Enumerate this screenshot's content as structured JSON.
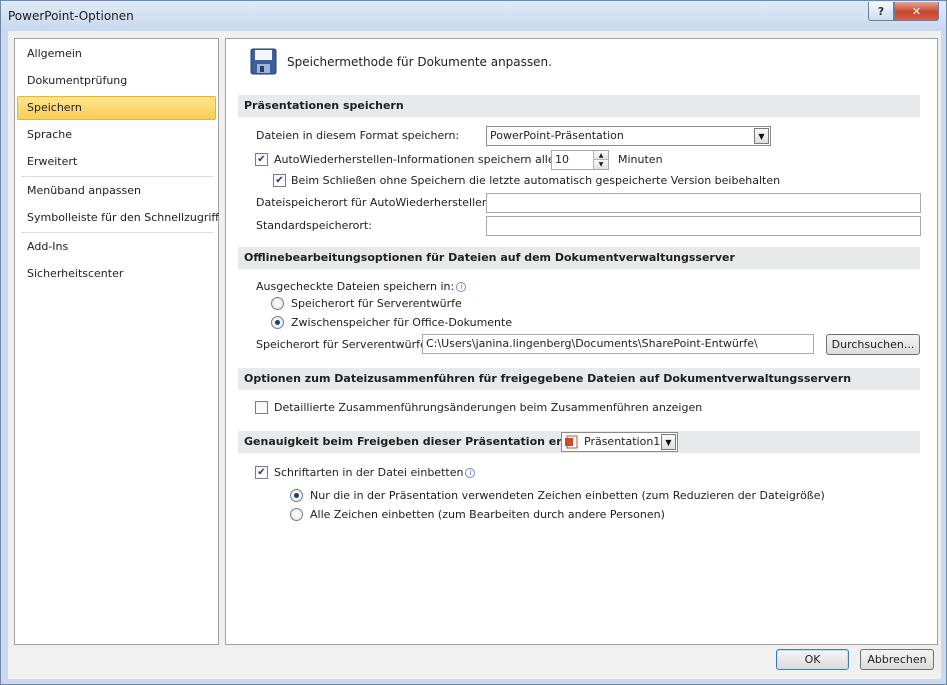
{
  "window": {
    "title": "PowerPoint-Optionen",
    "help_glyph": "?",
    "close_glyph": "✕"
  },
  "nav": {
    "items": [
      {
        "label": "Allgemein"
      },
      {
        "label": "Dokumentprüfung"
      },
      {
        "label": "Speichern"
      },
      {
        "label": "Sprache"
      },
      {
        "label": "Erweitert"
      },
      {
        "label": "Menüband anpassen"
      },
      {
        "label": "Symbolleiste für den Schnellzugriff"
      },
      {
        "label": "Add-Ins"
      },
      {
        "label": "Sicherheitscenter"
      }
    ],
    "selected": "Speichern"
  },
  "header": {
    "icon": "floppy-disk-icon",
    "text": "Speichermethode für Dokumente anpassen."
  },
  "save_section": {
    "title": "Präsentationen speichern",
    "format_label": "Dateien in diesem Format speichern:",
    "format_value": "PowerPoint-Präsentation",
    "autorecover_label": "AutoWiederherstellen-Informationen speichern alle",
    "autorecover_checked": true,
    "autorecover_minutes": "10",
    "minutes_label": "Minuten",
    "keep_last_label": "Beim Schließen ohne Speichern die letzte automatisch gespeicherte Version beibehalten",
    "keep_last_checked": true,
    "autorecover_location_label": "Dateispeicherort für AutoWiederherstellen:",
    "autorecover_location_value": "",
    "default_location_label": "Standardspeicherort:",
    "default_location_value": ""
  },
  "offline_section": {
    "title": "Offlinebearbeitungsoptionen für Dateien auf dem Dokumentverwaltungsserver",
    "checkout_label": "Ausgecheckte Dateien speichern in:",
    "radio_server_drafts": "Speicherort für Serverentwürfe",
    "radio_office_cache": "Zwischenspeicher für Office-Dokumente",
    "selected_radio": "office_cache",
    "drafts_location_label": "Speicherort für Serverentwürfe:",
    "drafts_location_value": "C:\\Users\\janina.lingenberg\\Documents\\SharePoint-Entwürfe\\",
    "browse_label": "Durchsuchen..."
  },
  "merge_section": {
    "title": "Optionen zum Dateizusammenführen für freigegebene Dateien auf Dokumentverwaltungsservern",
    "detailed_merge_label": "Detaillierte Zusammenführungsänderungen beim Zusammenführen anzeigen",
    "detailed_merge_checked": false
  },
  "fidelity_section": {
    "title": "Genauigkeit beim Freigeben dieser Präsentation erhalten:",
    "presentation_value": "Präsentation1",
    "embed_fonts_label": "Schriftarten in der Datei einbetten",
    "embed_fonts_checked": true,
    "embed_used_only_label": "Nur die in der Präsentation verwendeten Zeichen einbetten (zum Reduzieren der Dateigröße)",
    "embed_all_label": "Alle Zeichen einbetten (zum Bearbeiten durch andere Personen)",
    "selected_embed": "used_only"
  },
  "footer": {
    "ok_label": "OK",
    "cancel_label": "Abbrechen"
  },
  "colors": {
    "selected_nav": "#f9cf55",
    "section_header": "#e8e9ea",
    "close_button": "#c8452c"
  }
}
